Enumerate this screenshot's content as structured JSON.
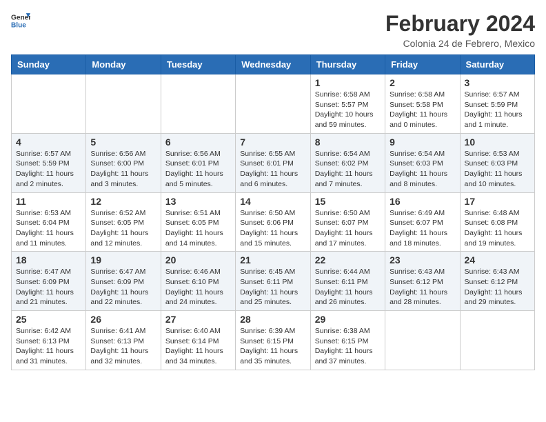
{
  "header": {
    "logo_general": "General",
    "logo_blue": "Blue",
    "calendar_title": "February 2024",
    "calendar_subtitle": "Colonia 24 de Febrero, Mexico"
  },
  "columns": [
    "Sunday",
    "Monday",
    "Tuesday",
    "Wednesday",
    "Thursday",
    "Friday",
    "Saturday"
  ],
  "weeks": [
    [
      {
        "day": "",
        "info": ""
      },
      {
        "day": "",
        "info": ""
      },
      {
        "day": "",
        "info": ""
      },
      {
        "day": "",
        "info": ""
      },
      {
        "day": "1",
        "info": "Sunrise: 6:58 AM\nSunset: 5:57 PM\nDaylight: 10 hours and 59 minutes."
      },
      {
        "day": "2",
        "info": "Sunrise: 6:58 AM\nSunset: 5:58 PM\nDaylight: 11 hours and 0 minutes."
      },
      {
        "day": "3",
        "info": "Sunrise: 6:57 AM\nSunset: 5:59 PM\nDaylight: 11 hours and 1 minute."
      }
    ],
    [
      {
        "day": "4",
        "info": "Sunrise: 6:57 AM\nSunset: 5:59 PM\nDaylight: 11 hours and 2 minutes."
      },
      {
        "day": "5",
        "info": "Sunrise: 6:56 AM\nSunset: 6:00 PM\nDaylight: 11 hours and 3 minutes."
      },
      {
        "day": "6",
        "info": "Sunrise: 6:56 AM\nSunset: 6:01 PM\nDaylight: 11 hours and 5 minutes."
      },
      {
        "day": "7",
        "info": "Sunrise: 6:55 AM\nSunset: 6:01 PM\nDaylight: 11 hours and 6 minutes."
      },
      {
        "day": "8",
        "info": "Sunrise: 6:54 AM\nSunset: 6:02 PM\nDaylight: 11 hours and 7 minutes."
      },
      {
        "day": "9",
        "info": "Sunrise: 6:54 AM\nSunset: 6:03 PM\nDaylight: 11 hours and 8 minutes."
      },
      {
        "day": "10",
        "info": "Sunrise: 6:53 AM\nSunset: 6:03 PM\nDaylight: 11 hours and 10 minutes."
      }
    ],
    [
      {
        "day": "11",
        "info": "Sunrise: 6:53 AM\nSunset: 6:04 PM\nDaylight: 11 hours and 11 minutes."
      },
      {
        "day": "12",
        "info": "Sunrise: 6:52 AM\nSunset: 6:05 PM\nDaylight: 11 hours and 12 minutes."
      },
      {
        "day": "13",
        "info": "Sunrise: 6:51 AM\nSunset: 6:05 PM\nDaylight: 11 hours and 14 minutes."
      },
      {
        "day": "14",
        "info": "Sunrise: 6:50 AM\nSunset: 6:06 PM\nDaylight: 11 hours and 15 minutes."
      },
      {
        "day": "15",
        "info": "Sunrise: 6:50 AM\nSunset: 6:07 PM\nDaylight: 11 hours and 17 minutes."
      },
      {
        "day": "16",
        "info": "Sunrise: 6:49 AM\nSunset: 6:07 PM\nDaylight: 11 hours and 18 minutes."
      },
      {
        "day": "17",
        "info": "Sunrise: 6:48 AM\nSunset: 6:08 PM\nDaylight: 11 hours and 19 minutes."
      }
    ],
    [
      {
        "day": "18",
        "info": "Sunrise: 6:47 AM\nSunset: 6:09 PM\nDaylight: 11 hours and 21 minutes."
      },
      {
        "day": "19",
        "info": "Sunrise: 6:47 AM\nSunset: 6:09 PM\nDaylight: 11 hours and 22 minutes."
      },
      {
        "day": "20",
        "info": "Sunrise: 6:46 AM\nSunset: 6:10 PM\nDaylight: 11 hours and 24 minutes."
      },
      {
        "day": "21",
        "info": "Sunrise: 6:45 AM\nSunset: 6:11 PM\nDaylight: 11 hours and 25 minutes."
      },
      {
        "day": "22",
        "info": "Sunrise: 6:44 AM\nSunset: 6:11 PM\nDaylight: 11 hours and 26 minutes."
      },
      {
        "day": "23",
        "info": "Sunrise: 6:43 AM\nSunset: 6:12 PM\nDaylight: 11 hours and 28 minutes."
      },
      {
        "day": "24",
        "info": "Sunrise: 6:43 AM\nSunset: 6:12 PM\nDaylight: 11 hours and 29 minutes."
      }
    ],
    [
      {
        "day": "25",
        "info": "Sunrise: 6:42 AM\nSunset: 6:13 PM\nDaylight: 11 hours and 31 minutes."
      },
      {
        "day": "26",
        "info": "Sunrise: 6:41 AM\nSunset: 6:13 PM\nDaylight: 11 hours and 32 minutes."
      },
      {
        "day": "27",
        "info": "Sunrise: 6:40 AM\nSunset: 6:14 PM\nDaylight: 11 hours and 34 minutes."
      },
      {
        "day": "28",
        "info": "Sunrise: 6:39 AM\nSunset: 6:15 PM\nDaylight: 11 hours and 35 minutes."
      },
      {
        "day": "29",
        "info": "Sunrise: 6:38 AM\nSunset: 6:15 PM\nDaylight: 11 hours and 37 minutes."
      },
      {
        "day": "",
        "info": ""
      },
      {
        "day": "",
        "info": ""
      }
    ]
  ]
}
